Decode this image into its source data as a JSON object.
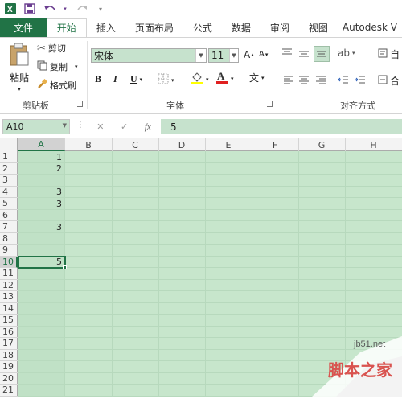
{
  "quick_access": {
    "excel_icon": "excel-logo",
    "save_icon": "save-icon",
    "undo_icon": "undo-icon",
    "redo_icon": "redo-icon",
    "customize_icon": "customize-icon"
  },
  "tabs": [
    {
      "label": "文件"
    },
    {
      "label": "开始"
    },
    {
      "label": "插入"
    },
    {
      "label": "页面布局"
    },
    {
      "label": "公式"
    },
    {
      "label": "数据"
    },
    {
      "label": "审阅"
    },
    {
      "label": "视图"
    },
    {
      "label": "Autodesk V"
    }
  ],
  "clipboard": {
    "paste": "粘贴",
    "cut": "剪切",
    "copy": "复制",
    "format_painter": "格式刷",
    "group": "剪贴板"
  },
  "font": {
    "name": "宋体",
    "size": "11",
    "group": "字体",
    "bold": "B",
    "italic": "I",
    "underline": "U",
    "grow": "A",
    "shrink": "A",
    "phonetic": "文"
  },
  "alignment": {
    "group": "对齐方式",
    "wrap": "自",
    "merge": "合"
  },
  "formula_bar": {
    "name_box": "A10",
    "fx": "fx",
    "value": "5"
  },
  "columns": [
    "A",
    "B",
    "C",
    "D",
    "E",
    "F",
    "G",
    "H"
  ],
  "rows": [
    "1",
    "2",
    "3",
    "4",
    "5",
    "6",
    "7",
    "8",
    "9",
    "10",
    "11",
    "12",
    "13",
    "14",
    "15",
    "16",
    "17",
    "18",
    "19",
    "20",
    "21"
  ],
  "cells": [
    {
      "row": 1,
      "col": "A",
      "value": "1"
    },
    {
      "row": 2,
      "col": "A",
      "value": "2"
    },
    {
      "row": 4,
      "col": "A",
      "value": "3"
    },
    {
      "row": 5,
      "col": "A",
      "value": "3"
    },
    {
      "row": 7,
      "col": "A",
      "value": "3"
    },
    {
      "row": 10,
      "col": "A",
      "value": "5"
    }
  ],
  "selected": {
    "row": 10,
    "col": "A"
  },
  "watermark": {
    "text1": "jb51.net",
    "text2": "脚本之家"
  },
  "colors": {
    "accent": "#217346",
    "grid_bg": "#c7e6cc",
    "field_bg": "#c6e2cd"
  }
}
